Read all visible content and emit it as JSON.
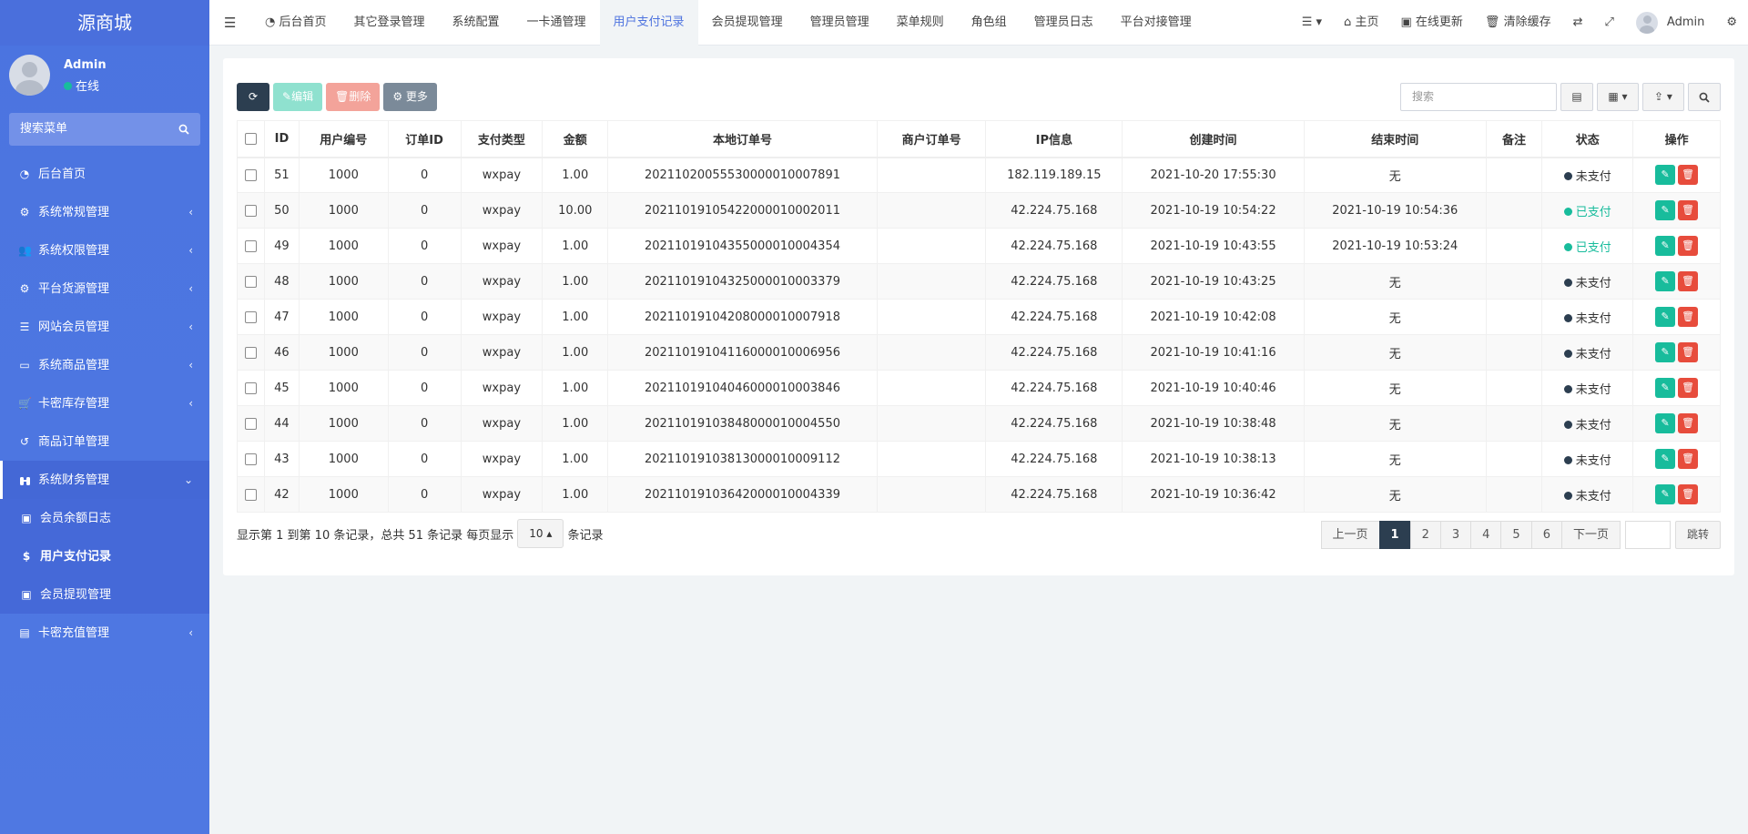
{
  "sidebar": {
    "brand": "源商城",
    "user": {
      "name": "Admin",
      "status": "在线"
    },
    "search_label": "搜索菜单",
    "items": [
      {
        "label": "后台首页",
        "icon": "dashboard-icon",
        "glyph": "◔",
        "has_children": false
      },
      {
        "label": "系统常规管理",
        "icon": "cogs-icon",
        "glyph": "⚙",
        "has_children": true
      },
      {
        "label": "系统权限管理",
        "icon": "users-icon",
        "glyph": "👥",
        "has_children": true
      },
      {
        "label": "平台货源管理",
        "icon": "cogs-icon",
        "glyph": "⚙",
        "has_children": true
      },
      {
        "label": "网站会员管理",
        "icon": "list-icon",
        "glyph": "☰",
        "has_children": true
      },
      {
        "label": "系统商品管理",
        "icon": "barcode-icon",
        "glyph": "▭",
        "has_children": true
      },
      {
        "label": "卡密库存管理",
        "icon": "cart-icon",
        "glyph": "🛒",
        "has_children": true
      },
      {
        "label": "商品订单管理",
        "icon": "history-icon",
        "glyph": "↺",
        "has_children": false
      }
    ],
    "open_group": {
      "label": "系统财务管理",
      "icon": "binoculars-icon",
      "children": [
        {
          "label": "会员余额日志",
          "icon": "money-icon",
          "glyph": "▣"
        },
        {
          "label": "用户支付记录",
          "icon": "dollar-icon",
          "glyph": "$"
        },
        {
          "label": "会员提现管理",
          "icon": "money-icon",
          "glyph": "▣"
        }
      ]
    },
    "last_item": {
      "label": "卡密充值管理",
      "icon": "credit-card-icon",
      "glyph": "▤"
    }
  },
  "topbar": {
    "tabs": [
      {
        "label": "后台首页",
        "icon": "dashboard-icon"
      },
      {
        "label": "其它登录管理"
      },
      {
        "label": "系统配置"
      },
      {
        "label": "一卡通管理"
      },
      {
        "label": "用户支付记录",
        "active": true
      },
      {
        "label": "会员提现管理"
      },
      {
        "label": "管理员管理"
      },
      {
        "label": "菜单规则"
      },
      {
        "label": "角色组"
      },
      {
        "label": "管理员日志"
      },
      {
        "label": "平台对接管理"
      }
    ],
    "right": {
      "home": "主页",
      "update": "在线更新",
      "clear_cache": "清除缓存",
      "admin": "Admin"
    }
  },
  "toolbar": {
    "edit": "编辑",
    "delete": "删除",
    "more": "更多",
    "search_placeholder": "搜索"
  },
  "table": {
    "columns": [
      "ID",
      "用户编号",
      "订单ID",
      "支付类型",
      "金额",
      "本地订单号",
      "商户订单号",
      "IP信息",
      "创建时间",
      "结束时间",
      "备注",
      "状态",
      "操作"
    ],
    "rows": [
      {
        "id": "51",
        "user": "1000",
        "order_id": "0",
        "pay_type": "wxpay",
        "amount": "1.00",
        "local_no": "20211020055530000010007891",
        "merchant_no": "",
        "ip": "182.119.189.15",
        "created": "2021-10-20 17:55:30",
        "ended": "无",
        "note": "",
        "status": "未支付",
        "paid": false
      },
      {
        "id": "50",
        "user": "1000",
        "order_id": "0",
        "pay_type": "wxpay",
        "amount": "10.00",
        "local_no": "20211019105422000010002011",
        "merchant_no": "",
        "ip": "42.224.75.168",
        "created": "2021-10-19 10:54:22",
        "ended": "2021-10-19 10:54:36",
        "note": "",
        "status": "已支付",
        "paid": true
      },
      {
        "id": "49",
        "user": "1000",
        "order_id": "0",
        "pay_type": "wxpay",
        "amount": "1.00",
        "local_no": "20211019104355000010004354",
        "merchant_no": "",
        "ip": "42.224.75.168",
        "created": "2021-10-19 10:43:55",
        "ended": "2021-10-19 10:53:24",
        "note": "",
        "status": "已支付",
        "paid": true
      },
      {
        "id": "48",
        "user": "1000",
        "order_id": "0",
        "pay_type": "wxpay",
        "amount": "1.00",
        "local_no": "20211019104325000010003379",
        "merchant_no": "",
        "ip": "42.224.75.168",
        "created": "2021-10-19 10:43:25",
        "ended": "无",
        "note": "",
        "status": "未支付",
        "paid": false
      },
      {
        "id": "47",
        "user": "1000",
        "order_id": "0",
        "pay_type": "wxpay",
        "amount": "1.00",
        "local_no": "20211019104208000010007918",
        "merchant_no": "",
        "ip": "42.224.75.168",
        "created": "2021-10-19 10:42:08",
        "ended": "无",
        "note": "",
        "status": "未支付",
        "paid": false
      },
      {
        "id": "46",
        "user": "1000",
        "order_id": "0",
        "pay_type": "wxpay",
        "amount": "1.00",
        "local_no": "20211019104116000010006956",
        "merchant_no": "",
        "ip": "42.224.75.168",
        "created": "2021-10-19 10:41:16",
        "ended": "无",
        "note": "",
        "status": "未支付",
        "paid": false
      },
      {
        "id": "45",
        "user": "1000",
        "order_id": "0",
        "pay_type": "wxpay",
        "amount": "1.00",
        "local_no": "20211019104046000010003846",
        "merchant_no": "",
        "ip": "42.224.75.168",
        "created": "2021-10-19 10:40:46",
        "ended": "无",
        "note": "",
        "status": "未支付",
        "paid": false
      },
      {
        "id": "44",
        "user": "1000",
        "order_id": "0",
        "pay_type": "wxpay",
        "amount": "1.00",
        "local_no": "20211019103848000010004550",
        "merchant_no": "",
        "ip": "42.224.75.168",
        "created": "2021-10-19 10:38:48",
        "ended": "无",
        "note": "",
        "status": "未支付",
        "paid": false
      },
      {
        "id": "43",
        "user": "1000",
        "order_id": "0",
        "pay_type": "wxpay",
        "amount": "1.00",
        "local_no": "20211019103813000010009112",
        "merchant_no": "",
        "ip": "42.224.75.168",
        "created": "2021-10-19 10:38:13",
        "ended": "无",
        "note": "",
        "status": "未支付",
        "paid": false
      },
      {
        "id": "42",
        "user": "1000",
        "order_id": "0",
        "pay_type": "wxpay",
        "amount": "1.00",
        "local_no": "20211019103642000010004339",
        "merchant_no": "",
        "ip": "42.224.75.168",
        "created": "2021-10-19 10:36:42",
        "ended": "无",
        "note": "",
        "status": "未支付",
        "paid": false
      }
    ]
  },
  "pagination": {
    "info": "显示第 1 到第 10 条记录，总共 51 条记录 每页显示",
    "page_size": "10",
    "suffix": "条记录",
    "prev": "上一页",
    "pages": [
      "1",
      "2",
      "3",
      "4",
      "5",
      "6"
    ],
    "current": "1",
    "next": "下一页",
    "jump": "跳转"
  },
  "colors": {
    "sidebar": "#4e73df",
    "primary_dark": "#2c3e50",
    "success": "#18bc9c",
    "danger": "#e74c3c",
    "active_tab_text": "#4e73df"
  }
}
